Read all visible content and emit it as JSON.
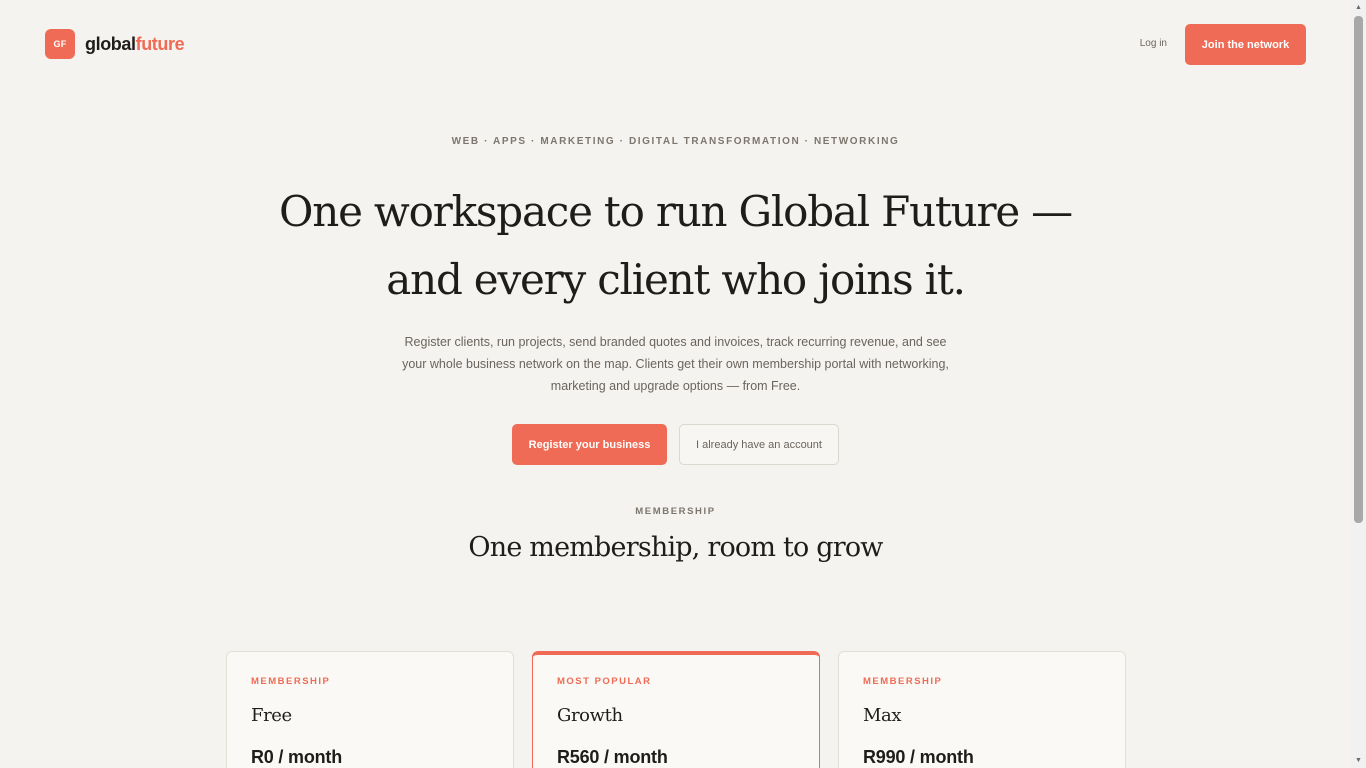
{
  "header": {
    "logo_mark": "GF",
    "logo_text_part1": "global",
    "logo_text_part2": "future",
    "login_label": "Log in",
    "join_label": "Join the network"
  },
  "hero": {
    "eyebrow": "WEB · APPS · MARKETING · DIGITAL TRANSFORMATION · NETWORKING",
    "title_line1": "One workspace to run Global Future —",
    "title_line2": "and every client who joins it.",
    "subtitle": "Register clients, run projects, send branded quotes and invoices, track recurring revenue, and see your whole business network on the map. Clients get their own membership portal with networking, marketing and upgrade options — from Free.",
    "cta_primary": "Register your business",
    "cta_secondary": "I already have an account"
  },
  "membership": {
    "eyebrow": "MEMBERSHIP",
    "title": "One membership, room to grow",
    "cards": [
      {
        "tag": "MEMBERSHIP",
        "name": "Free",
        "price": "R0 / month"
      },
      {
        "tag": "MOST POPULAR",
        "name": "Growth",
        "price": "R560 / month"
      },
      {
        "tag": "MEMBERSHIP",
        "name": "Max",
        "price": "R990 / month"
      }
    ]
  },
  "colors": {
    "accent": "#ef6b55",
    "background": "#f5f3ef",
    "text": "#1f1d1b",
    "muted": "#6a645d"
  }
}
